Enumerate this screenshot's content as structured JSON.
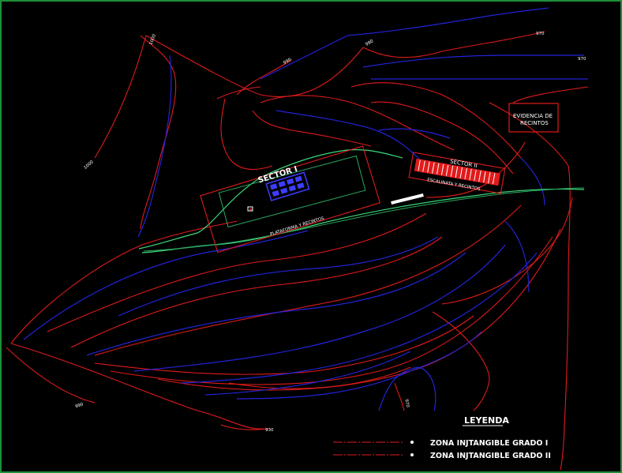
{
  "contour_labels": [
    "1000",
    "990",
    "980",
    "970",
    "970",
    "1000",
    "990",
    "930",
    "970"
  ],
  "sectors": {
    "sector1": {
      "title": "SECTOR   I",
      "sublabel": "PLATAFORMA Y RECINTOS"
    },
    "sector2": {
      "title": "SECTOR II",
      "sublabel": "ESCALINATA Y RECINTOS"
    }
  },
  "evidence_box": {
    "line1": "EVIDENCIA DE",
    "line2": "RECINTOS"
  },
  "legend": {
    "title": "LEYENDA",
    "items": [
      {
        "label": "ZONA INJTANGIBLE GRADO I",
        "color": "#e01b1b"
      },
      {
        "label": "ZONA INJTANGIBLE GRADO II",
        "color": "#e01b1b"
      }
    ]
  },
  "colors": {
    "background": "#000000",
    "frame": "#1f8f3a",
    "contour_red": "#e01b1b",
    "contour_blue": "#2323d8",
    "path_green": "#3cd97a"
  }
}
